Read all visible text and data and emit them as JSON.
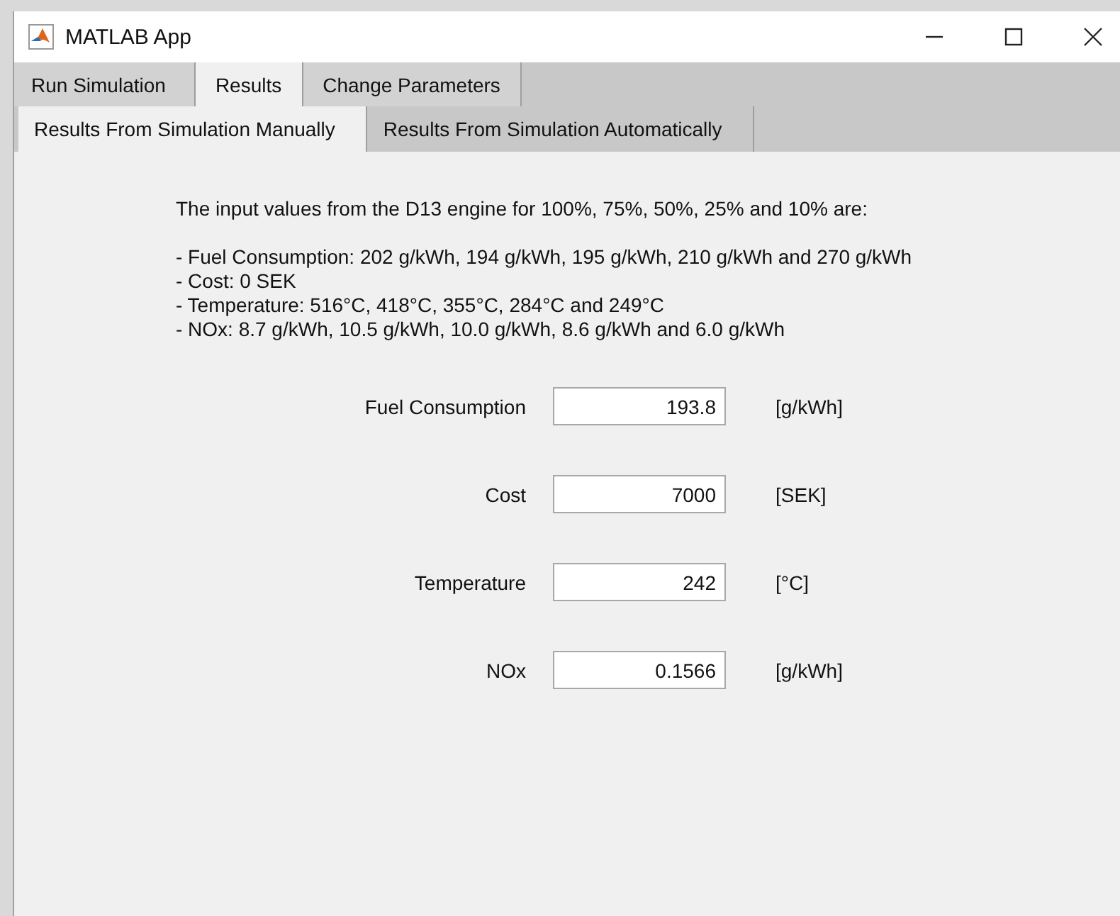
{
  "window": {
    "title": "MATLAB App"
  },
  "tabs": [
    {
      "label": "Run Simulation",
      "selected": false
    },
    {
      "label": "Results",
      "selected": true
    },
    {
      "label": "Change Parameters",
      "selected": false
    }
  ],
  "subtabs": [
    {
      "label": "Results From Simulation Manually",
      "selected": true
    },
    {
      "label": "Results From Simulation Automatically",
      "selected": false
    }
  ],
  "intro": "The input values from the D13 engine for 100%, 75%, 50%, 25% and 10% are:",
  "input_lines": [
    "- Fuel Consumption: 202 g/kWh, 194 g/kWh, 195 g/kWh, 210 g/kWh and 270 g/kWh",
    "- Cost: 0 SEK",
    "- Temperature: 516°C, 418°C, 355°C, 284°C and 249°C",
    "- NOx: 8.7 g/kWh, 10.5 g/kWh, 10.0 g/kWh, 8.6 g/kWh and 6.0 g/kWh"
  ],
  "results": [
    {
      "label": "Fuel Consumption",
      "value": "193.8",
      "unit": "[g/kWh]"
    },
    {
      "label": "Cost",
      "value": "7000",
      "unit": "[SEK]"
    },
    {
      "label": "Temperature",
      "value": "242",
      "unit": "[°C]"
    },
    {
      "label": "NOx",
      "value": "0.1566",
      "unit": "[g/kWh]"
    }
  ]
}
